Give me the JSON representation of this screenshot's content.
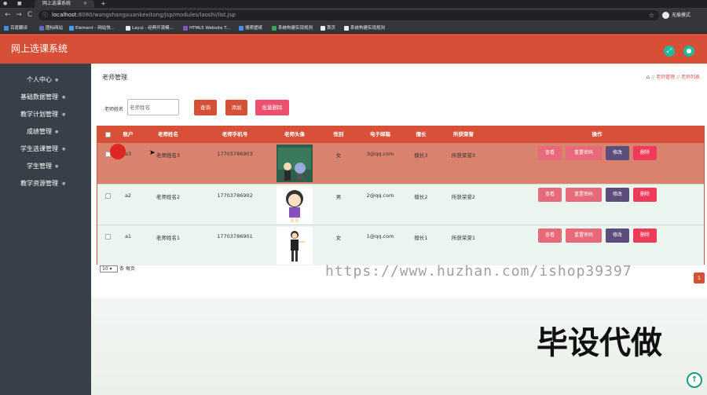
{
  "browser": {
    "tab_title": "网上选课系统",
    "tab_close": "×",
    "new_tab": "+",
    "back": "←",
    "forward": "→",
    "reload": "C",
    "url_host": "localhost",
    "url_path": ":8080/wangshangxuankexitong/jsp/modules/laoshi/list.jsp",
    "info": "ⓘ",
    "star": "☆",
    "profile_label": "无痕模式",
    "bookmarks": [
      "百度翻译",
      "图标网站",
      "Element - 网站快...",
      "Layui - 经典开源模...",
      "HTML5 Website T...",
      "搜索壁纸",
      "系统构建实现规则",
      "首页",
      "系统构建实现规则"
    ],
    "bookmark_colors": [
      "#4a8af4",
      "#5c6bc0",
      "#409eff",
      "#e8eaed",
      "#7e57c2",
      "#4a8af4",
      "#34a853",
      "#e8eaed",
      "#e8eaed"
    ]
  },
  "app": {
    "title": "网上选课系统",
    "header_icons": [
      "fullscreen-icon",
      "user-icon"
    ],
    "accent_color": "#d74f36"
  },
  "sidebar": {
    "items": [
      {
        "label": "个人中心"
      },
      {
        "label": "基础数据管理"
      },
      {
        "label": "教学计划管理"
      },
      {
        "label": "成绩管理"
      },
      {
        "label": "学生选课管理"
      },
      {
        "label": "学生管理"
      },
      {
        "label": "教学资源管理"
      }
    ]
  },
  "page": {
    "title": "老师管理",
    "breadcrumb": [
      "老师管理",
      "老师列表"
    ],
    "breadcrumb_sep": "//"
  },
  "search": {
    "label": "老师姓名",
    "placeholder": "老师姓名",
    "search_btn": "查询",
    "add_btn": "添加",
    "batch_delete_btn": "批量删除"
  },
  "table": {
    "headers": [
      "账户",
      "老师姓名",
      "老师手机号",
      "老师头像",
      "性别",
      "电子邮箱",
      "擅长",
      "所获荣誉",
      "操作"
    ],
    "actions": {
      "view": "查看",
      "reset": "重置密码",
      "edit": "修改",
      "delete": "删除"
    },
    "rows": [
      {
        "account": "a3",
        "name": "老师姓名3",
        "phone": "17703786903",
        "gender": "女",
        "email": "3@qq.com",
        "skill": "擅长3",
        "honor": "所获荣誉3"
      },
      {
        "account": "a2",
        "name": "老师姓名2",
        "phone": "17703786902",
        "gender": "男",
        "email": "2@qq.com",
        "skill": "擅长2",
        "honor": "所获荣誉2"
      },
      {
        "account": "a1",
        "name": "老师姓名1",
        "phone": "17703786901",
        "gender": "女",
        "email": "1@qq.com",
        "skill": "擅长1",
        "honor": "所获荣誉1"
      }
    ]
  },
  "pager": {
    "page_size": "10",
    "per_page_label": "条 每页",
    "current_page": "1"
  },
  "watermark": {
    "url": "https://www.huzhan.com/ishop39397",
    "text": "毕设代做"
  },
  "scroll_top": "↑"
}
